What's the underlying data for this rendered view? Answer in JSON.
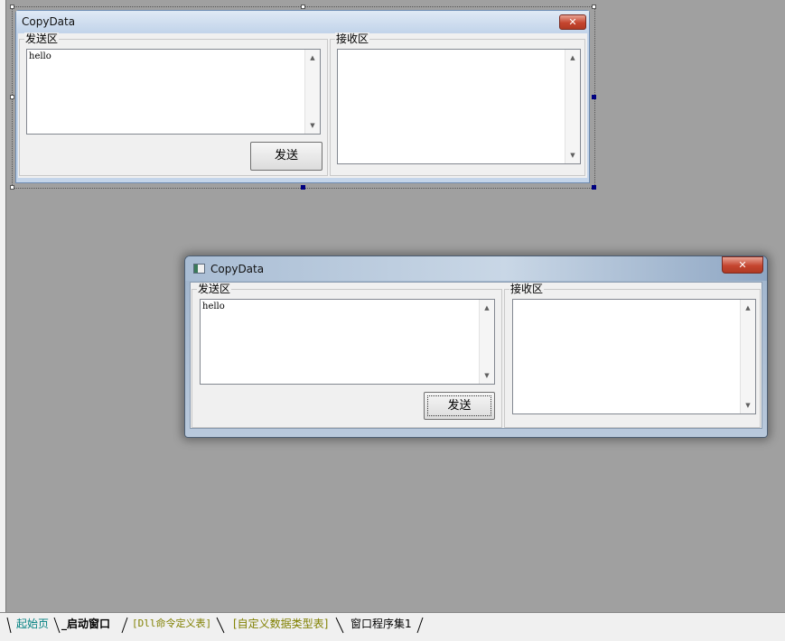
{
  "design_window": {
    "title": "CopyData",
    "send_group_label": "发送区",
    "recv_group_label": "接收区",
    "send_text": "hello",
    "send_button": "发送"
  },
  "runtime_window": {
    "title": "CopyData",
    "close_glyph": "x",
    "send_group_label": "发送区",
    "recv_group_label": "接收区",
    "send_text": "hello",
    "send_button": "发送"
  },
  "tabs": [
    {
      "label": "起始页",
      "color": "#008080"
    },
    {
      "label": "_启动窗口",
      "color": "#000000",
      "bold": true
    },
    {
      "label": "[Dll命令定义表]",
      "color": "#808000"
    },
    {
      "label": "[自定义数据类型表]",
      "color": "#808000"
    },
    {
      "label": "窗口程序集1",
      "color": "#000000"
    }
  ],
  "icons": {
    "close": "close-icon",
    "scroll_up": "triangle-up",
    "scroll_down": "triangle-down",
    "app": "window-icon"
  }
}
